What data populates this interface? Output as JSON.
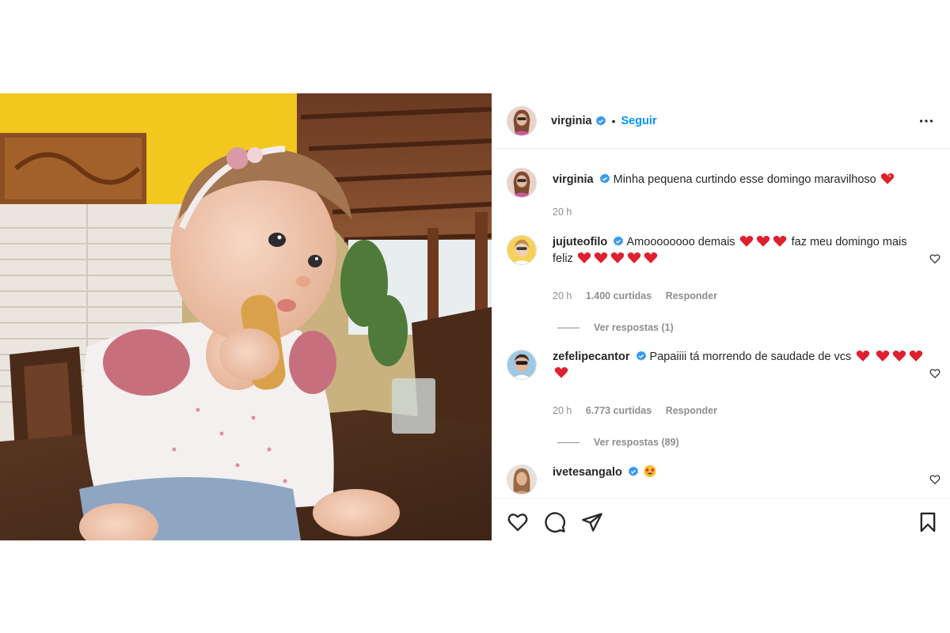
{
  "post": {
    "author": "virginia",
    "follow_label": "Seguir",
    "separator": "•"
  },
  "caption": {
    "username": "virginia",
    "text": "Minha pequena curtindo esse domingo maravilhoso",
    "time": "20 h"
  },
  "comments": [
    {
      "username": "jujuteofilo",
      "text_part1": "Amoooooooo demais",
      "text_part2": "faz meu domingo mais feliz",
      "time": "20 h",
      "likes": "1.400 curtidas",
      "reply": "Responder",
      "view_replies": "Ver respostas (1)"
    },
    {
      "username": "zefelipecantor",
      "text": "Papaiiii tá morrendo de saudade de vcs",
      "time": "20 h",
      "likes": "6.773 curtidas",
      "reply": "Responder",
      "view_replies": "Ver respostas (89)"
    },
    {
      "username": "ivetesangalo"
    }
  ],
  "colors": {
    "link_blue": "#0095f6",
    "verified_blue": "#3897f0",
    "text": "#262626",
    "muted": "#8e8e8e",
    "heart_red": "#e0202e"
  },
  "icons": {
    "like": "heart-outline-icon",
    "comment": "speech-bubble-icon",
    "share": "paper-plane-icon",
    "save": "bookmark-icon",
    "more": "three-dots-icon"
  }
}
